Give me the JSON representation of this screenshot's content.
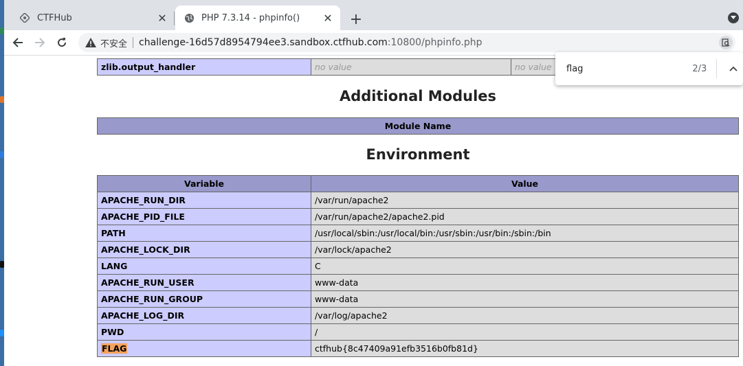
{
  "browser": {
    "tabs": [
      {
        "title": "CTFHub",
        "close": "✕"
      },
      {
        "title": "PHP 7.3.14 - phpinfo()",
        "close": "✕"
      }
    ],
    "new_tab": "+",
    "address": {
      "insecure_label": "不安全",
      "host": "challenge-16d57d8954794ee3.sandbox.ctfhub.com",
      "rest": ":10800/phpinfo.php"
    }
  },
  "find": {
    "query": "flag",
    "count": "2/3"
  },
  "page": {
    "zlib_row": {
      "name": "zlib.output_handler",
      "local": "no value",
      "master": "no value"
    },
    "modules": {
      "title": "Additional Modules",
      "header": "Module Name"
    },
    "environment": {
      "title": "Environment",
      "headers": [
        "Variable",
        "Value"
      ],
      "rows": [
        {
          "name": "APACHE_RUN_DIR",
          "value": "/var/run/apache2"
        },
        {
          "name": "APACHE_PID_FILE",
          "value": "/var/run/apache2/apache2.pid"
        },
        {
          "name": "PATH",
          "value": "/usr/local/sbin:/usr/local/bin:/usr/sbin:/usr/bin:/sbin:/bin"
        },
        {
          "name": "APACHE_LOCK_DIR",
          "value": "/var/lock/apache2"
        },
        {
          "name": "LANG",
          "value": "C"
        },
        {
          "name": "APACHE_RUN_USER",
          "value": "www-data"
        },
        {
          "name": "APACHE_RUN_GROUP",
          "value": "www-data"
        },
        {
          "name": "APACHE_LOG_DIR",
          "value": "/var/log/apache2"
        },
        {
          "name": "PWD",
          "value": "/"
        },
        {
          "name": "FLAG",
          "value": "ctfhub{8c47409a91efb3516b0fb81d}"
        }
      ]
    }
  },
  "colors": {
    "highlight": "#f5a25d",
    "header": "#9999cc",
    "key_cell": "#ccccff",
    "value_cell": "#dddddd"
  }
}
